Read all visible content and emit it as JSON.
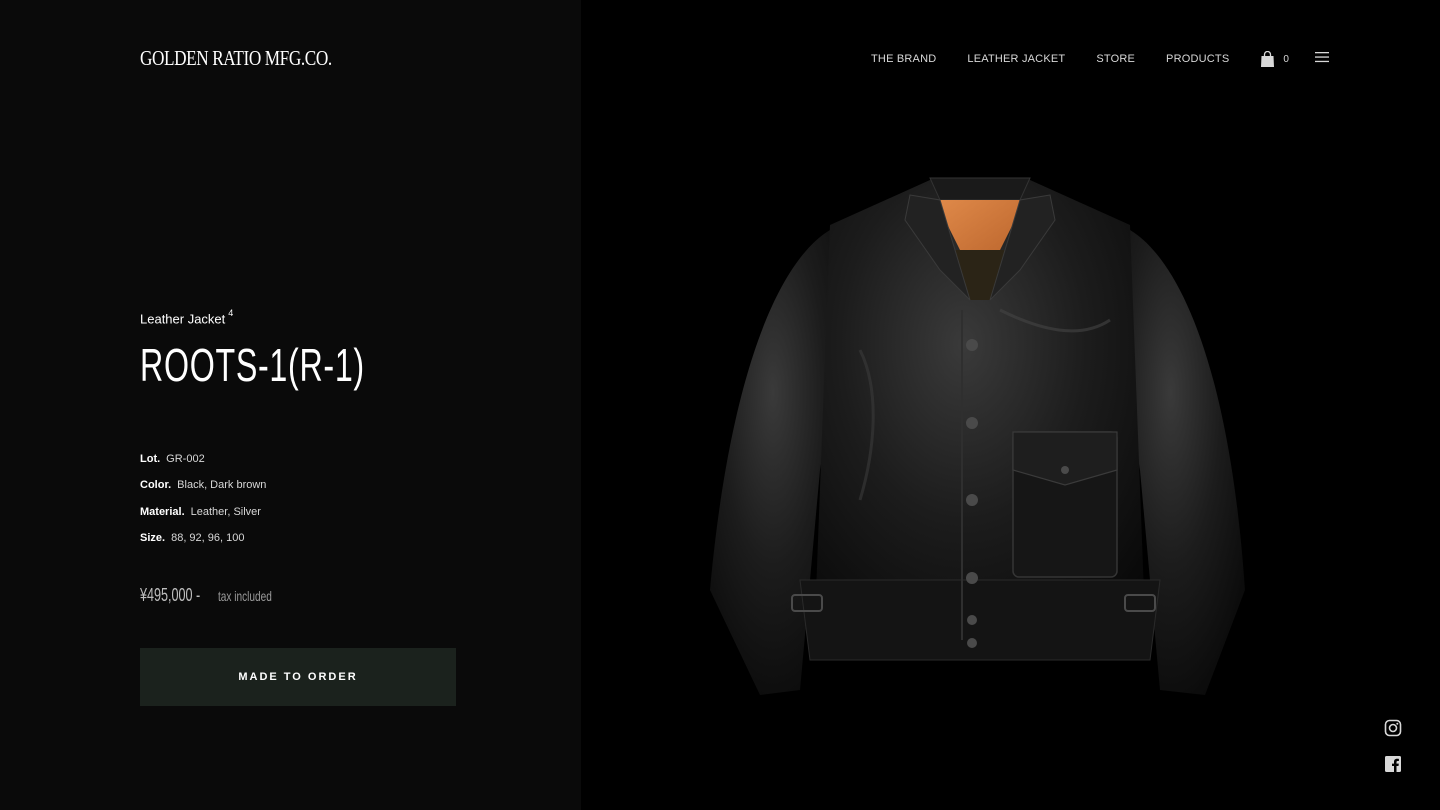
{
  "brand": {
    "logo": "GOLDEN RATIO MFG.CO."
  },
  "nav": {
    "items": [
      {
        "label": "THE BRAND"
      },
      {
        "label": "LEATHER JACKET"
      },
      {
        "label": "STORE"
      },
      {
        "label": "PRODUCTS"
      }
    ],
    "cart_count": "0",
    "cart_icon": "shopping-bag-icon",
    "menu_icon": "hamburger-menu-icon"
  },
  "product": {
    "category": "Leather Jacket",
    "category_count": "4",
    "name": "ROOTS-1(R-1)",
    "specs": [
      {
        "key": "Lot.",
        "value": "GR-002"
      },
      {
        "key": "Color.",
        "value": "Black, Dark brown"
      },
      {
        "key": "Material.",
        "value": "Leather, Silver"
      },
      {
        "key": "Size.",
        "value": "88, 92, 96, 100"
      }
    ],
    "price": "¥495,000 -",
    "tax_note": "tax included",
    "cta_label": "MADE TO ORDER",
    "image": "black-leather-jacket-photo"
  },
  "social": {
    "instagram_icon": "instagram-icon",
    "facebook_icon": "facebook-icon"
  },
  "colors": {
    "left_panel_bg": "#0a0a0a",
    "right_panel_bg": "#000000",
    "cta_bg": "#1b221d",
    "text": "#ffffff"
  }
}
